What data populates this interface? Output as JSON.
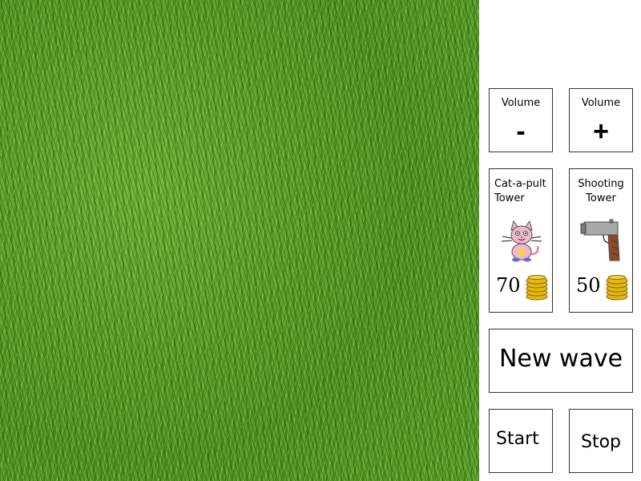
{
  "controls": {
    "volume_down": {
      "label": "Volume",
      "sign": "-"
    },
    "volume_up": {
      "label": "Volume",
      "sign": "+"
    }
  },
  "shop": {
    "catapult": {
      "title": "Cat-a-pult Tower",
      "price": "70",
      "icon": "cat-icon"
    },
    "shooting": {
      "title": "Shooting Tower",
      "price": "50",
      "icon": "gun-icon"
    }
  },
  "actions": {
    "new_wave": "New wave",
    "start": "Start",
    "stop": "Stop"
  },
  "colors": {
    "grass": "#5a9e2a",
    "panel": "#ffffff",
    "border": "#333333",
    "coin": "#e2b612"
  }
}
